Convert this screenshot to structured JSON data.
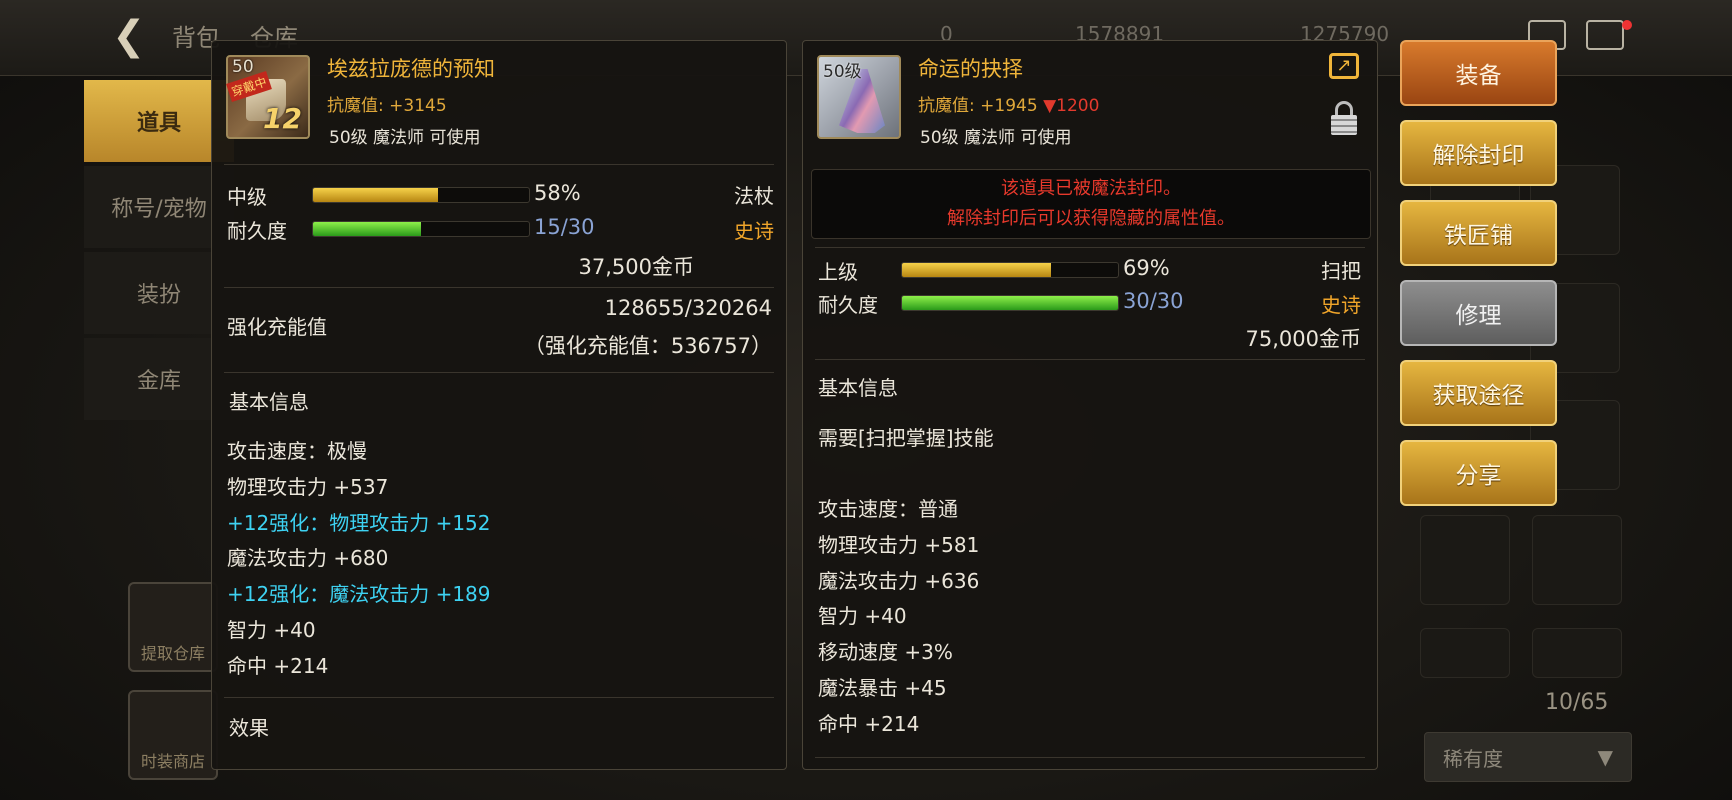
{
  "background": {
    "tabs": [
      "背包",
      "仓库"
    ],
    "currencies": [
      "0",
      "1578891",
      "1275790"
    ],
    "menu": [
      "道具",
      "称号/宠物",
      "装扮",
      "金库"
    ],
    "slot_labels": [
      "提取仓库",
      "时装商店"
    ],
    "inventory_count": "10/65",
    "sort_label": "稀有度"
  },
  "left_item": {
    "level_badge": "50",
    "equipped_badge": "穿戴中",
    "reinforce": "12",
    "name": "埃兹拉庞德的预知",
    "resist_label": "抗魔值:",
    "resist_value": "+3145",
    "requirement": "50级 魔法师 可使用",
    "grade": "中级",
    "grade_pct": 58,
    "grade_text": "58%",
    "durability_label": "耐久度",
    "durability_value": 15,
    "durability_max": 30,
    "durability_text": "15/30",
    "type": "法杖",
    "rarity": "史诗",
    "price": "37,500金币",
    "charge_label": "强化充能值",
    "charge_value": "128655/320264",
    "charge_total": "（强化充能值：536757）",
    "basic_info": "基本信息",
    "stats": [
      {
        "text": "攻击速度：极慢",
        "color": "normal"
      },
      {
        "text": "物理攻击力 +537",
        "color": "normal"
      },
      {
        "text": "+12强化：物理攻击力 +152",
        "color": "cyan"
      },
      {
        "text": "魔法攻击力 +680",
        "color": "normal"
      },
      {
        "text": "+12强化：魔法攻击力 +189",
        "color": "cyan"
      },
      {
        "text": "智力 +40",
        "color": "normal"
      },
      {
        "text": "命中 +214",
        "color": "normal"
      }
    ],
    "effect_label": "效果"
  },
  "right_item": {
    "level_badge": "50级",
    "name": "命运的抉择",
    "resist_label": "抗魔值:",
    "resist_value": "+1945",
    "resist_diff": "▼1200",
    "requirement": "50级 魔法师 可使用",
    "seal_line1": "该道具已被魔法封印。",
    "seal_line2": "解除封印后可以获得隐藏的属性值。",
    "grade": "上级",
    "grade_pct": 69,
    "grade_text": "69%",
    "durability_label": "耐久度",
    "durability_value": 30,
    "durability_max": 30,
    "durability_text": "30/30",
    "type": "扫把",
    "rarity": "史诗",
    "price": "75,000金币",
    "basic_info": "基本信息",
    "skill_req": "需要[扫把掌握]技能",
    "stats": [
      "攻击速度：普通",
      "物理攻击力 +581",
      "魔法攻击力 +636",
      "智力 +40",
      "移动速度 +3%",
      "魔法暴击 +45",
      "命中 +214"
    ]
  },
  "actions": {
    "equip": "装备",
    "unseal": "解除封印",
    "smith": "铁匠铺",
    "repair": "修理",
    "obtain": "获取途径",
    "share": "分享"
  },
  "colors": {
    "name": "#f0b53a",
    "cyan_stat": "#3ed2f2",
    "seal_text": "#e8392c",
    "rarity": "#f0a52a"
  }
}
